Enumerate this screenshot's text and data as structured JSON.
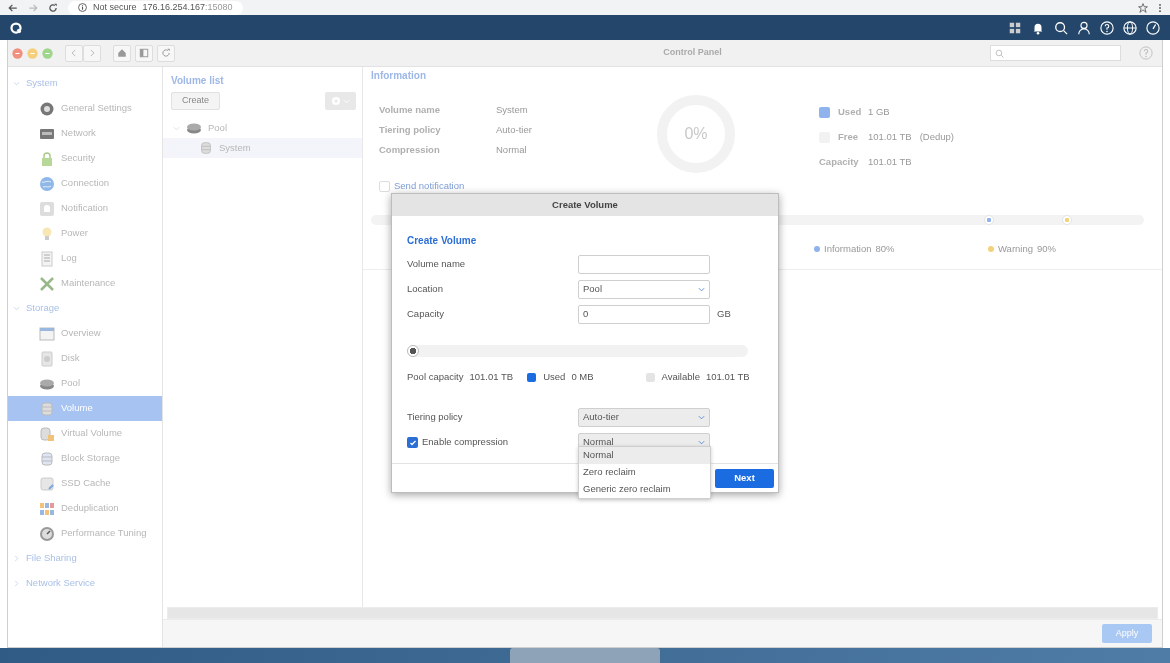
{
  "browser": {
    "security": "Not secure",
    "host": "176.16.254.167",
    "port": ":15080"
  },
  "window": {
    "title": "Control Panel"
  },
  "sidebar": {
    "groups": [
      {
        "label": "System",
        "expanded": true,
        "items": [
          {
            "label": "General Settings",
            "selected": false
          },
          {
            "label": "Network",
            "selected": false
          },
          {
            "label": "Security",
            "selected": false
          },
          {
            "label": "Connection",
            "selected": false
          },
          {
            "label": "Notification",
            "selected": false
          },
          {
            "label": "Power",
            "selected": false
          },
          {
            "label": "Log",
            "selected": false
          },
          {
            "label": "Maintenance",
            "selected": false
          }
        ]
      },
      {
        "label": "Storage",
        "expanded": true,
        "items": [
          {
            "label": "Overview",
            "selected": false
          },
          {
            "label": "Disk",
            "selected": false
          },
          {
            "label": "Pool",
            "selected": false
          },
          {
            "label": "Volume",
            "selected": true
          },
          {
            "label": "Virtual Volume",
            "selected": false
          },
          {
            "label": "Block Storage",
            "selected": false
          },
          {
            "label": "SSD Cache",
            "selected": false
          },
          {
            "label": "Deduplication",
            "selected": false
          },
          {
            "label": "Performance Tuning",
            "selected": false
          }
        ]
      },
      {
        "label": "File Sharing",
        "expanded": false
      },
      {
        "label": "Network Service",
        "expanded": false
      }
    ]
  },
  "volume_list": {
    "title": "Volume list",
    "create_button": "Create",
    "tree": [
      {
        "label": "Pool",
        "expanded": true,
        "selected": false,
        "children": [
          {
            "label": "System",
            "selected": true
          }
        ]
      }
    ]
  },
  "information": {
    "title": "Information",
    "fields": [
      {
        "label": "Volume name",
        "value": "System"
      },
      {
        "label": "Tiering policy",
        "value": "Auto-tier"
      },
      {
        "label": "Compression",
        "value": "Normal"
      }
    ],
    "usage": "0%",
    "legend": [
      {
        "label": "Used",
        "value": "1 GB",
        "color": "#8fb3ec"
      },
      {
        "label": "Free",
        "value": "101.01 TB",
        "note": "(Dedup)",
        "color": "#f2f2f2"
      }
    ],
    "capacity": {
      "label": "Capacity",
      "value": "101.01 TB"
    },
    "send_notification": {
      "label": "Send notification",
      "checked": false
    },
    "thresholds": [
      {
        "label": "Information",
        "value": "80%",
        "color": "#8fb3ec",
        "level": 0.8
      },
      {
        "label": "Warning",
        "value": "90%",
        "color": "#f3d27e",
        "level": 0.9
      }
    ]
  },
  "dialog": {
    "title": "Create Volume",
    "heading": "Create Volume",
    "fields": [
      {
        "kind": "text",
        "label": "Volume name"
      },
      {
        "kind": "select",
        "label": "Location",
        "value": "Pool"
      },
      {
        "kind": "text",
        "label": "Capacity",
        "value": "0",
        "unit": "GB"
      }
    ],
    "slider": {
      "level": 0
    },
    "pool_capacity": {
      "label": "Pool capacity",
      "value": "101.01 TB"
    },
    "legend": [
      {
        "label": "Used",
        "value": "0 MB",
        "color": "#1a6ce0"
      },
      {
        "label": "Available",
        "value": "101.01 TB",
        "color": "#e4e4e4"
      }
    ],
    "tiering": {
      "label": "Tiering policy",
      "value": "Auto-tier"
    },
    "compression": {
      "label": "Enable compression",
      "checked": true,
      "value": "Normal",
      "expanded": true,
      "options": [
        {
          "label": "Normal",
          "selected": true
        },
        {
          "label": "Zero reclaim",
          "selected": false
        },
        {
          "label": "Generic zero reclaim",
          "selected": false
        }
      ]
    },
    "next_button": "Next"
  },
  "footer": {
    "apply_button": "Apply",
    "disabled": true
  }
}
